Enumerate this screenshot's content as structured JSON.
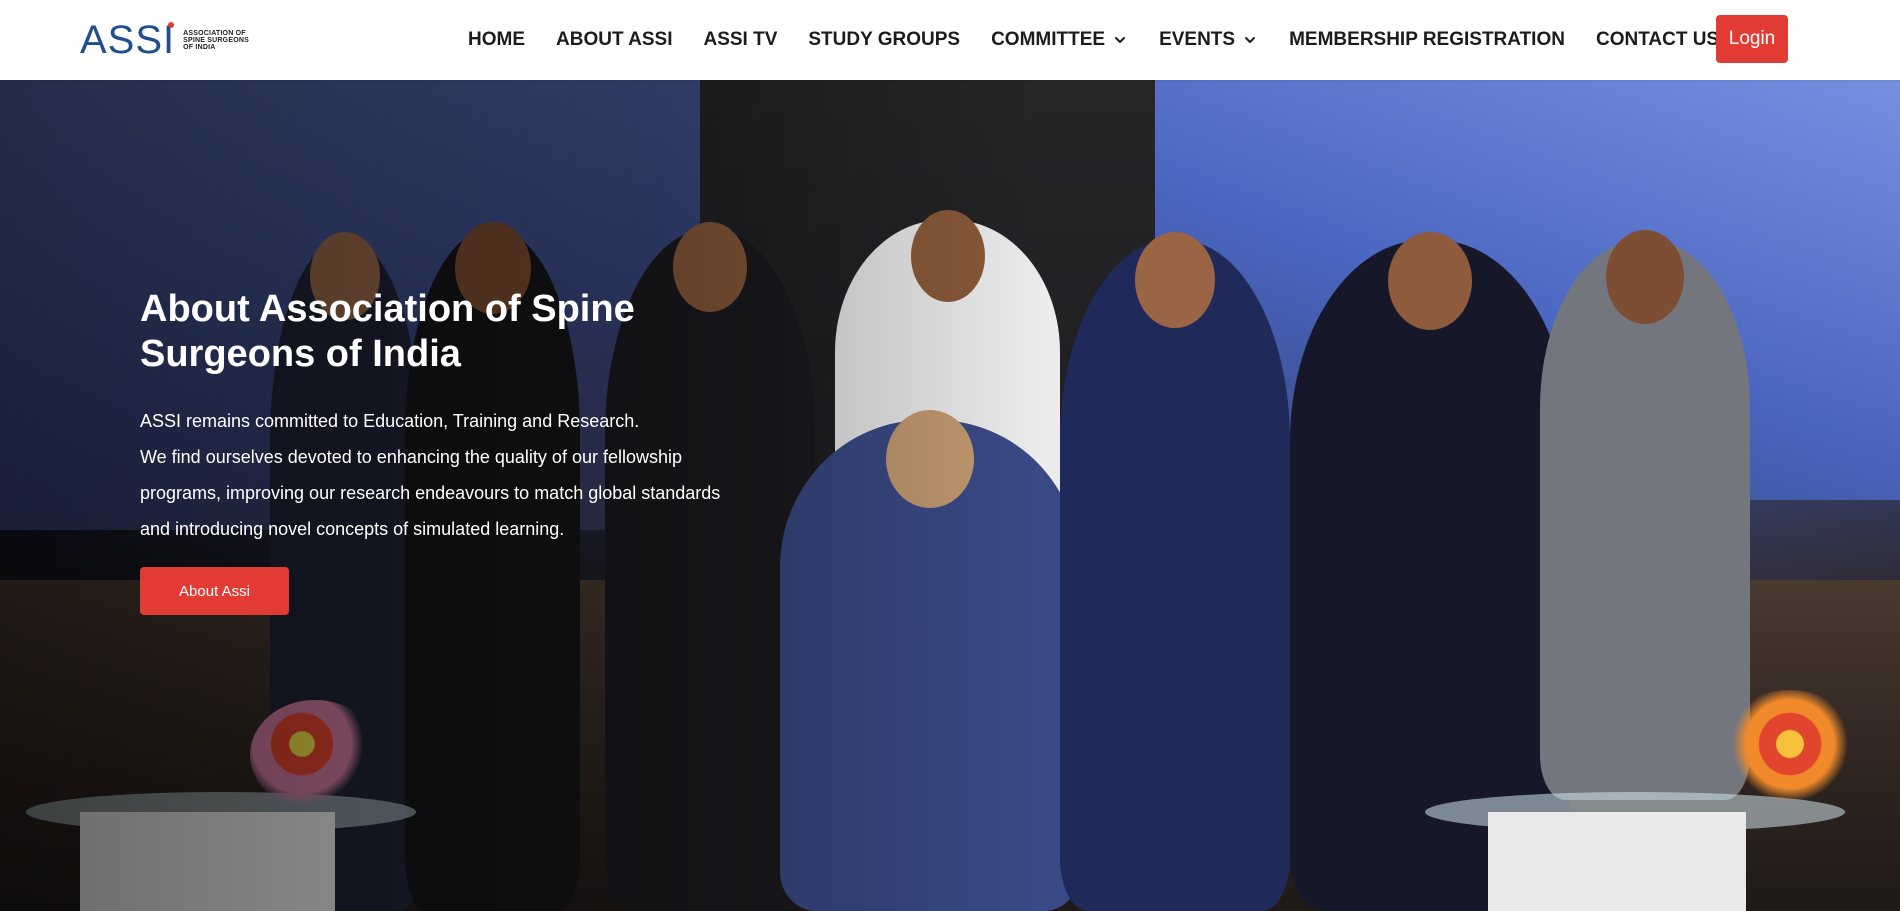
{
  "header": {
    "logo": {
      "mark": "ASSI",
      "subtitle_lines": [
        "ASSOCIATION OF",
        "SPINE SURGEONS",
        "OF INDIA"
      ]
    },
    "nav": [
      {
        "label": "HOME",
        "has_dropdown": false
      },
      {
        "label": "ABOUT ASSI",
        "has_dropdown": false
      },
      {
        "label": "ASSI TV",
        "has_dropdown": false
      },
      {
        "label": "STUDY GROUPS",
        "has_dropdown": false
      },
      {
        "label": "COMMITTEE",
        "has_dropdown": true
      },
      {
        "label": "EVENTS",
        "has_dropdown": true
      },
      {
        "label": "MEMBERSHIP REGISTRATION",
        "has_dropdown": false
      },
      {
        "label": "CONTACT US",
        "has_dropdown": false
      }
    ],
    "login_label": "Login"
  },
  "hero": {
    "title_line1": "About Association of Spine",
    "title_line2": "Surgeons of India",
    "text_lines": [
      "ASSI remains committed to Education, Training and Research.",
      "We find ourselves devoted to enhancing the quality of our fellowship",
      "programs, improving our research endeavours to match global standards",
      "and introducing novel concepts of simulated learning."
    ],
    "button_label": "About Assi"
  },
  "colors": {
    "accent": "#e23b33",
    "logo_blue": "#1f4f8c",
    "nav_text": "#1c1c1c"
  }
}
